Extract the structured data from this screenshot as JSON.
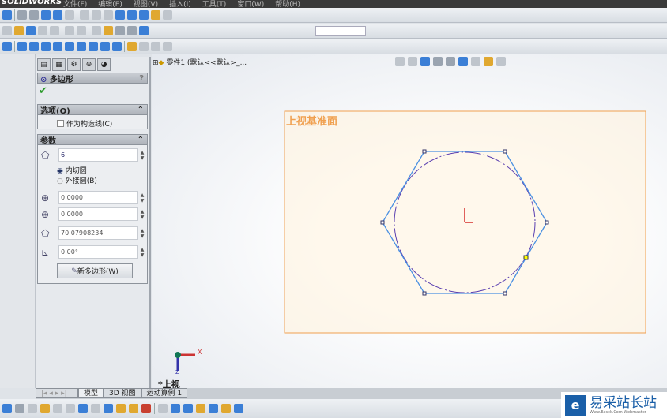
{
  "app": {
    "logo": "SOLIDWORKS",
    "menus": [
      "文件(F)",
      "编辑(E)",
      "视图(V)",
      "插入(I)",
      "工具(T)",
      "窗口(W)",
      "帮助(H)"
    ]
  },
  "tree": {
    "root": "零件1 (默认<<默认>_..."
  },
  "property_manager": {
    "title": "多边形",
    "help": "?",
    "options": {
      "header": "选项(O)",
      "construction_label": "作为构造线(C)",
      "construction_checked": false
    },
    "params": {
      "header": "参数",
      "sides": "6",
      "inscribed_label": "内切圆",
      "circumscribed_label": "外接圆(B)",
      "selected": "inscribed",
      "center_x": "0.0000",
      "center_y": "0.0000",
      "diameter": "70.07908234",
      "angle": "0.00°",
      "new_polygon_label": "新多边形(W)"
    }
  },
  "viewport": {
    "plane_label": "上视基准面",
    "view_label": "*上视",
    "axis_x": "X",
    "axis_z": "Z",
    "sketch_color": "#4a90e2",
    "circle_color": "#5a3fb0",
    "plane_color": "#f0a050"
  },
  "bottom_tabs": [
    "模型",
    "3D 视图",
    "运动算例 1"
  ],
  "watermark": {
    "text": "易采站长站",
    "sub": "Www.Easck.Com Webmaster"
  }
}
